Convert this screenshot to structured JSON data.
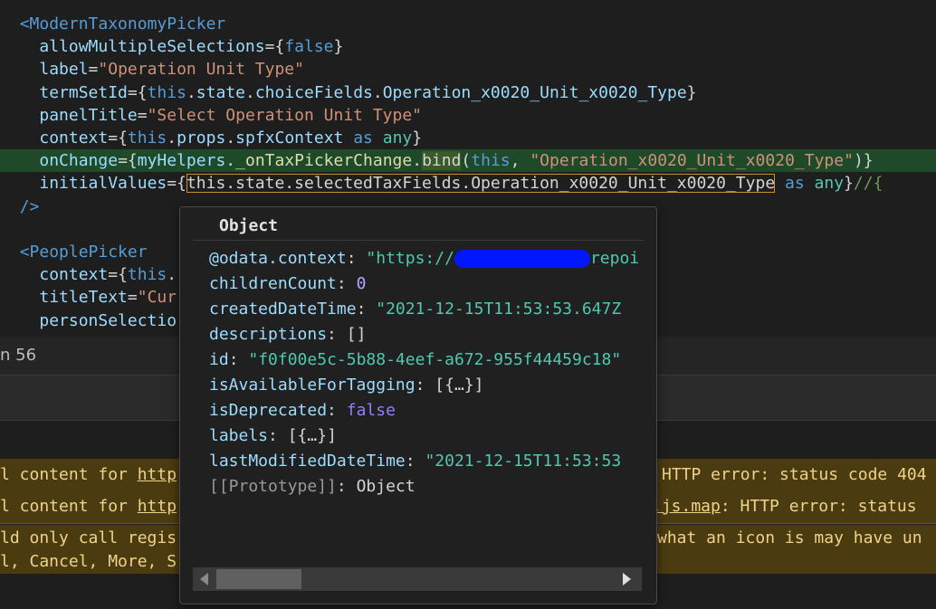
{
  "editor": {
    "lines": [
      {
        "parts": [
          [
            "tag",
            "<ModernTaxonomyPicker"
          ]
        ]
      },
      {
        "parts": [
          [
            "attr",
            "  allowMultipleSelections"
          ],
          [
            "brace",
            "={"
          ],
          [
            "kw",
            "false"
          ],
          [
            "brace",
            "}"
          ]
        ]
      },
      {
        "parts": [
          [
            "attr",
            "  label"
          ],
          [
            "brace",
            "="
          ],
          [
            "str",
            "\"Operation Unit Type\""
          ]
        ]
      },
      {
        "parts": [
          [
            "attr",
            "  termSetId"
          ],
          [
            "brace",
            "={"
          ],
          [
            "kw",
            "this"
          ],
          [
            "brace",
            "."
          ],
          [
            "attr",
            "state"
          ],
          [
            "brace",
            "."
          ],
          [
            "attr",
            "choiceFields"
          ],
          [
            "brace",
            "."
          ],
          [
            "attr",
            "Operation_x0020_Unit_x0020_Type"
          ],
          [
            "brace",
            "}"
          ]
        ]
      },
      {
        "parts": [
          [
            "attr",
            "  panelTitle"
          ],
          [
            "brace",
            "="
          ],
          [
            "str",
            "\"Select Operation Unit Type\""
          ]
        ]
      },
      {
        "parts": [
          [
            "attr",
            "  context"
          ],
          [
            "brace",
            "={"
          ],
          [
            "kw",
            "this"
          ],
          [
            "brace",
            "."
          ],
          [
            "attr",
            "props"
          ],
          [
            "brace",
            "."
          ],
          [
            "attr",
            "spfxContext"
          ],
          [
            "brace",
            " "
          ],
          [
            "kw",
            "as"
          ],
          [
            "brace",
            " "
          ],
          [
            "ty",
            "any"
          ],
          [
            "brace",
            "}"
          ]
        ]
      },
      {
        "highlight": true,
        "parts": [
          [
            "attr",
            "  onChange"
          ],
          [
            "brace",
            "={"
          ],
          [
            "attr",
            "myHelpers"
          ],
          [
            "brace",
            "."
          ],
          [
            "fn",
            "_onTaxPickerChange"
          ],
          [
            "brace",
            "."
          ],
          [
            "bindhl",
            "bind"
          ],
          [
            "brace",
            "("
          ],
          [
            "kw",
            "this"
          ],
          [
            "brace",
            ", "
          ],
          [
            "str",
            "\"Operation_x0020_Unit_x0020_Type\""
          ],
          [
            "brace",
            ")}"
          ]
        ]
      },
      {
        "parts": [
          [
            "attr",
            "  initialValues"
          ],
          [
            "brace",
            "={"
          ],
          [
            "boxed",
            "this.state.selectedTaxFields.Operation_x0020_Unit_x0020_Type"
          ],
          [
            "brace",
            " "
          ],
          [
            "kw",
            "as"
          ],
          [
            "brace",
            " "
          ],
          [
            "ty",
            "any"
          ],
          [
            "brace",
            "}"
          ],
          [
            "cmt",
            "//{"
          ]
        ]
      },
      {
        "parts": [
          [
            "tag",
            "/>"
          ]
        ]
      },
      {
        "parts": []
      },
      {
        "parts": [
          [
            "tag",
            "<PeoplePicker"
          ]
        ]
      },
      {
        "parts": [
          [
            "attr",
            "  context"
          ],
          [
            "brace",
            "={"
          ],
          [
            "kw",
            "this"
          ],
          [
            "brace",
            "."
          ]
        ]
      },
      {
        "parts": [
          [
            "attr",
            "  titleText"
          ],
          [
            "brace",
            "="
          ],
          [
            "str",
            "\"Cur"
          ]
        ]
      },
      {
        "parts": [
          [
            "attr",
            "  personSelectio"
          ]
        ]
      }
    ]
  },
  "status": {
    "line_text": "n 56"
  },
  "console": {
    "warn1": {
      "prefix": "l content for ",
      "link": "http",
      "suffix": "HTTP error: status code 404"
    },
    "warn2": {
      "prefix": "l content for ",
      "link": "http",
      "link2": ".js.map",
      "suffix": ": HTTP error: status"
    },
    "warn3": {
      "line1a": "ld only call regis",
      "line1b": "what an icon is may have un",
      "line2a": "l, Cancel, More, S"
    }
  },
  "popup": {
    "title": "Object",
    "props": [
      {
        "key": "@odata.context",
        "sep": ": ",
        "value": "\"https://",
        "redacted": true,
        "value_tail": "repoi",
        "kind": "str",
        "expandable": false
      },
      {
        "key": "childrenCount",
        "sep": ": ",
        "value": "0",
        "kind": "num",
        "expandable": false
      },
      {
        "key": "createdDateTime",
        "sep": ": ",
        "value": "\"2021-12-15T11:53:53.647Z",
        "kind": "str",
        "expandable": false
      },
      {
        "key": "descriptions",
        "sep": ": ",
        "value": "[]",
        "kind": "plain",
        "expandable": true
      },
      {
        "key": "id",
        "sep": ": ",
        "value": "\"f0f00e5c-5b88-4eef-a672-955f44459c18\"",
        "kind": "str",
        "expandable": false
      },
      {
        "key": "isAvailableForTagging",
        "sep": ": ",
        "value": "[{…}]",
        "kind": "plain",
        "expandable": true
      },
      {
        "key": "isDeprecated",
        "sep": ": ",
        "value": "false",
        "kind": "bool",
        "expandable": false
      },
      {
        "key": "labels",
        "sep": ": ",
        "value": "[{…}]",
        "kind": "plain",
        "expandable": true
      },
      {
        "key": "lastModifiedDateTime",
        "sep": ": ",
        "value": "\"2021-12-15T11:53:53",
        "kind": "str",
        "expandable": false
      },
      {
        "key": "[[Prototype]]",
        "sep": ": ",
        "value": "Object",
        "kind": "plain",
        "expandable": true,
        "proto": true
      }
    ]
  },
  "colors": {
    "background": "#1e1e1e",
    "highlight_line": "#1f4a2a",
    "warning_bg": "#4a3b10",
    "redaction": "#0016ff"
  },
  "icons": {
    "expand": "triangle-right-icon",
    "scroll_left": "arrow-left-icon",
    "scroll_right": "arrow-right-icon"
  }
}
